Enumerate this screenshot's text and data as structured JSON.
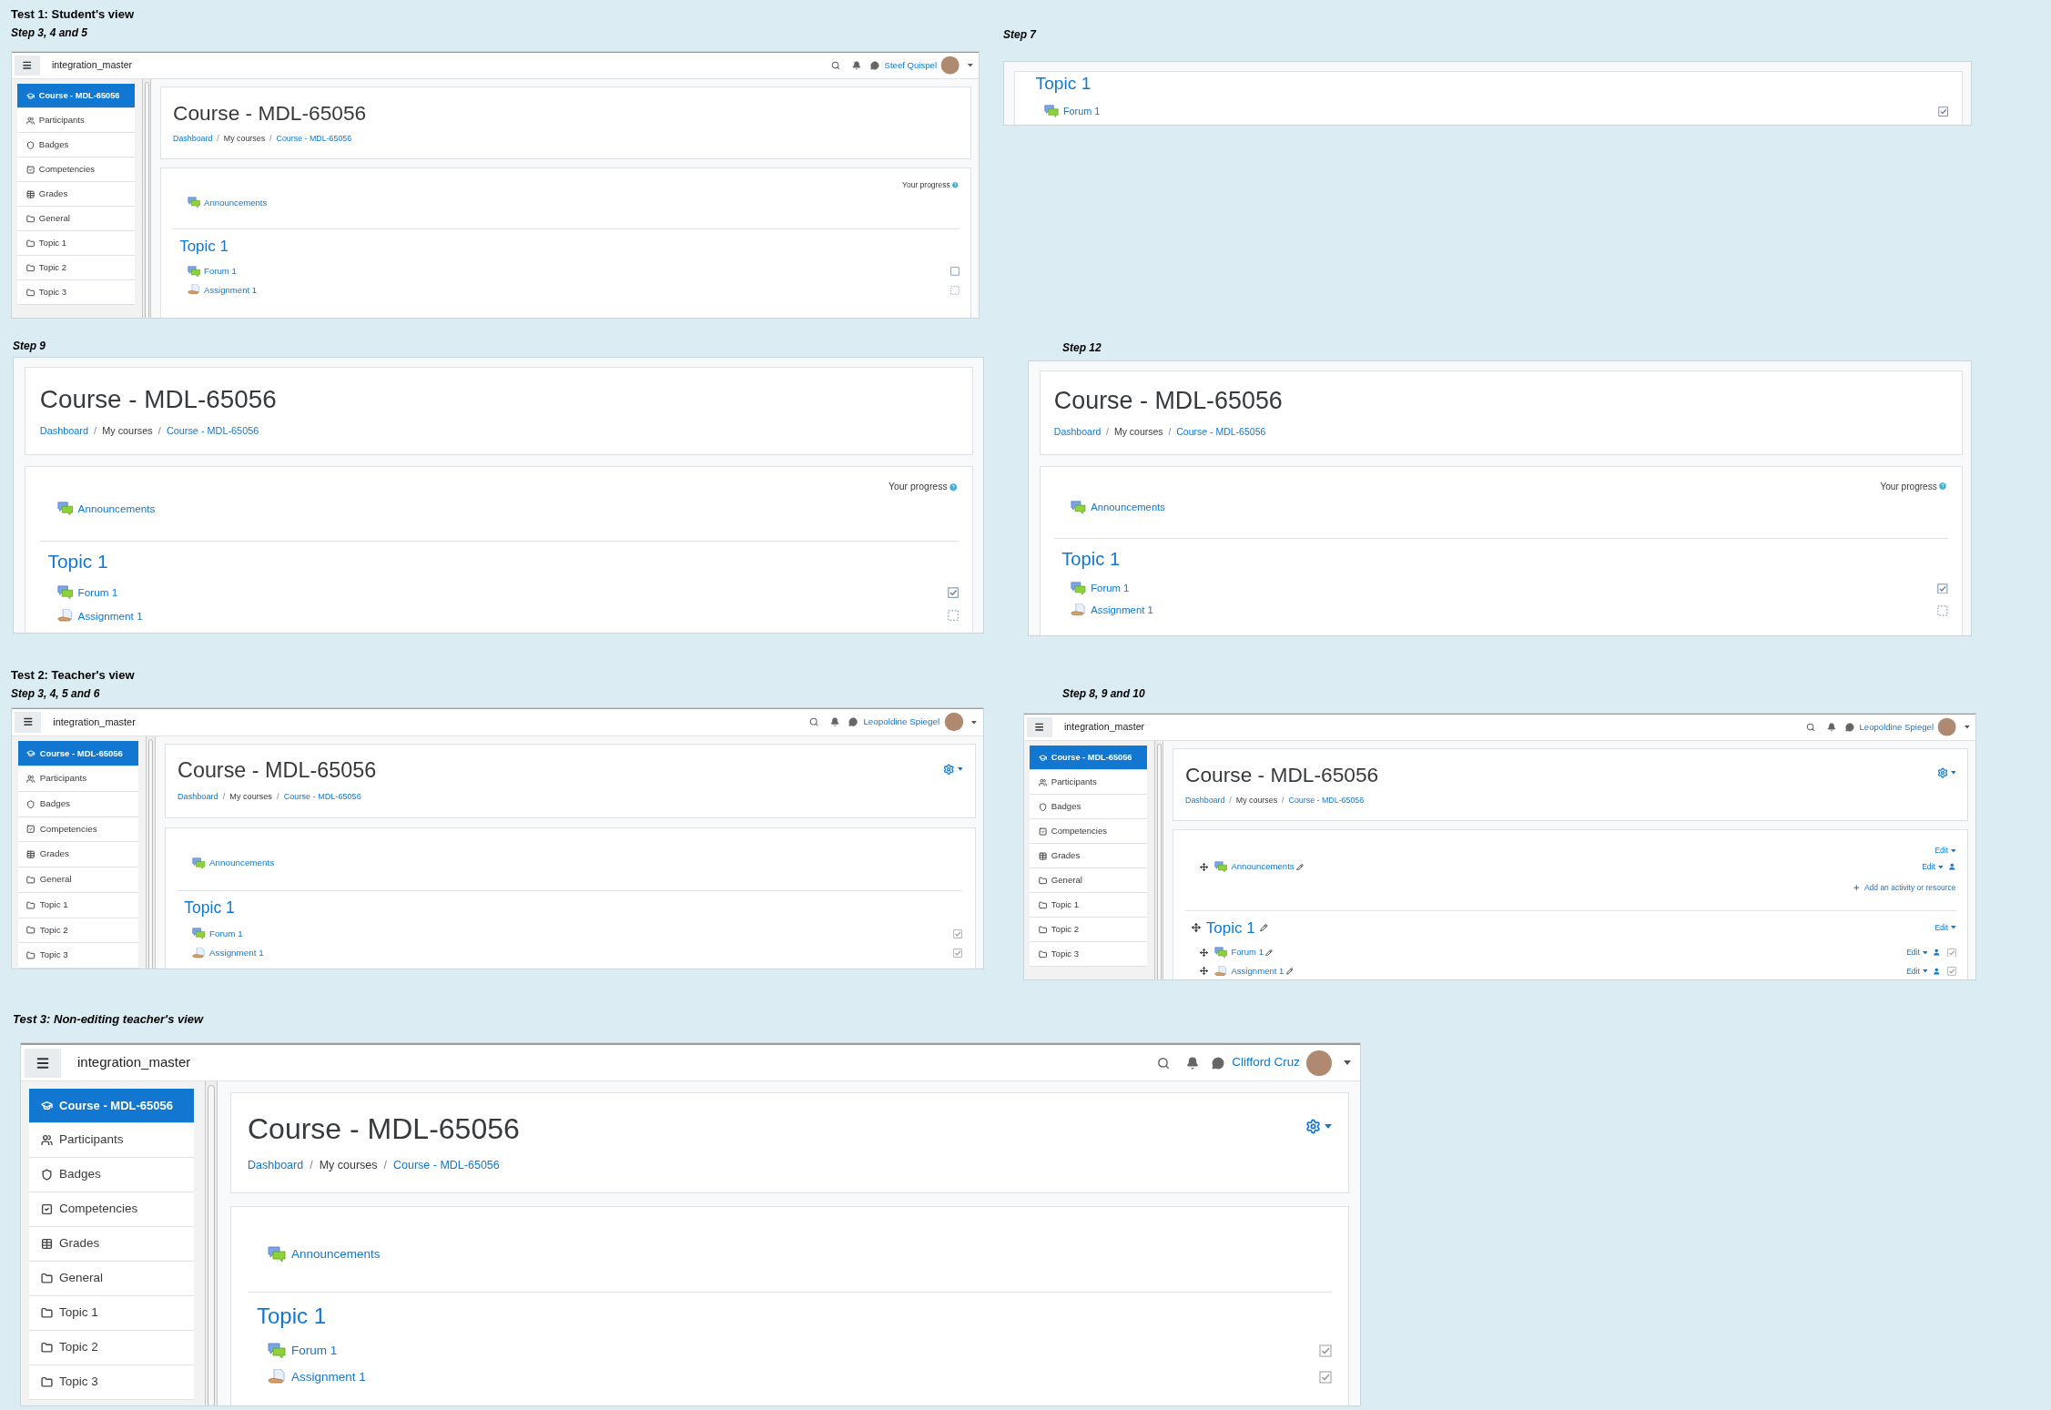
{
  "groups": [
    {
      "heading": {
        "text": "Test 1: Student's view",
        "italic": false
      },
      "step": "Step 3, 4 and 5",
      "screen": {
        "navbar": {
          "site": "integration_master",
          "user": "Steef Quispel"
        },
        "sidebar": [
          {
            "label": "Course - MDL-65056",
            "kind": "course",
            "selected": true
          },
          {
            "label": "Participants",
            "kind": "participants",
            "selected": false
          },
          {
            "label": "Badges",
            "kind": "badges",
            "selected": false
          },
          {
            "label": "Competencies",
            "kind": "competencies",
            "selected": false
          },
          {
            "label": "Grades",
            "kind": "grades",
            "selected": false
          },
          {
            "label": "General",
            "kind": "folder",
            "selected": false
          },
          {
            "label": "Topic 1",
            "kind": "folder",
            "selected": false
          },
          {
            "label": "Topic 2",
            "kind": "folder",
            "selected": false
          },
          {
            "label": "Topic 3",
            "kind": "folder",
            "selected": false
          }
        ],
        "header": {
          "title": "Course - MDL-65056",
          "gear": false,
          "breadcrumb": [
            {
              "label": "Dashboard",
              "link": true,
              "separator": "/"
            },
            {
              "label": "My courses",
              "link": false,
              "separator": "/"
            },
            {
              "label": "Course - MDL-65056",
              "link": true
            }
          ]
        },
        "content": {
          "editing": false,
          "progress": "Your progress",
          "sections": [
            {
              "activities": [
                {
                  "name": "Announcements",
                  "kind": "forum"
                }
              ]
            },
            {
              "title": "Topic 1",
              "activities": [
                {
                  "name": "Forum 1",
                  "kind": "forum",
                  "completion": {
                    "kind": "manual",
                    "checked": false,
                    "disabled": false
                  }
                },
                {
                  "name": "Assignment 1",
                  "kind": "assignment",
                  "completion": {
                    "kind": "auto",
                    "checked": false,
                    "disabled": false
                  }
                }
              ]
            }
          ]
        }
      }
    },
    {
      "step": "Step 7",
      "screen": {
        "content": {
          "editing": false,
          "sections": [
            {
              "title": "Topic 1",
              "activities": [
                {
                  "name": "Forum 1",
                  "kind": "forum",
                  "completion": {
                    "kind": "manual",
                    "checked": true,
                    "disabled": false
                  }
                }
              ]
            }
          ]
        }
      }
    },
    {
      "step": "Step 9",
      "screen": {
        "header": {
          "title": "Course - MDL-65056",
          "gear": false,
          "breadcrumb": [
            {
              "label": "Dashboard",
              "link": true,
              "separator": "/"
            },
            {
              "label": "My courses",
              "link": false,
              "separator": "/"
            },
            {
              "label": "Course - MDL-65056",
              "link": true
            }
          ]
        },
        "content": {
          "editing": false,
          "progress": "Your progress",
          "sections": [
            {
              "activities": [
                {
                  "name": "Announcements",
                  "kind": "forum"
                }
              ]
            },
            {
              "title": "Topic 1",
              "activities": [
                {
                  "name": "Forum 1",
                  "kind": "forum",
                  "completion": {
                    "kind": "manual",
                    "checked": true,
                    "disabled": false
                  }
                },
                {
                  "name": "Assignment 1",
                  "kind": "assignment",
                  "completion": {
                    "kind": "auto",
                    "checked": false,
                    "disabled": false
                  }
                }
              ]
            }
          ]
        }
      }
    },
    {
      "step": "Step 12",
      "screen": {
        "header": {
          "title": "Course - MDL-65056",
          "gear": false,
          "breadcrumb": [
            {
              "label": "Dashboard",
              "link": true,
              "separator": "/"
            },
            {
              "label": "My courses",
              "link": false,
              "separator": "/"
            },
            {
              "label": "Course - MDL-65056",
              "link": true
            }
          ]
        },
        "content": {
          "editing": false,
          "progress": "Your progress",
          "sections": [
            {
              "activities": [
                {
                  "name": "Announcements",
                  "kind": "forum"
                }
              ]
            },
            {
              "title": "Topic 1",
              "activities": [
                {
                  "name": "Forum 1",
                  "kind": "forum",
                  "completion": {
                    "kind": "manual",
                    "checked": true,
                    "disabled": false
                  }
                },
                {
                  "name": "Assignment 1",
                  "kind": "assignment",
                  "completion": {
                    "kind": "auto",
                    "checked": false,
                    "disabled": false
                  }
                }
              ]
            }
          ]
        }
      }
    },
    {
      "heading": {
        "text": "Test 2: Teacher's view",
        "italic": false
      },
      "step": "Step 3, 4, 5 and 6",
      "screen": {
        "navbar": {
          "site": "integration_master",
          "user": "Leopoldine Spiegel"
        },
        "sidebar": [
          {
            "label": "Course - MDL-65056",
            "kind": "course",
            "selected": true
          },
          {
            "label": "Participants",
            "kind": "participants",
            "selected": false
          },
          {
            "label": "Badges",
            "kind": "badges",
            "selected": false
          },
          {
            "label": "Competencies",
            "kind": "competencies",
            "selected": false
          },
          {
            "label": "Grades",
            "kind": "grades",
            "selected": false
          },
          {
            "label": "General",
            "kind": "folder",
            "selected": false
          },
          {
            "label": "Topic 1",
            "kind": "folder",
            "selected": false
          },
          {
            "label": "Topic 2",
            "kind": "folder",
            "selected": false
          },
          {
            "label": "Topic 3",
            "kind": "folder",
            "selected": false
          }
        ],
        "header": {
          "title": "Course - MDL-65056",
          "gear": true,
          "breadcrumb": [
            {
              "label": "Dashboard",
              "link": true,
              "separator": "/"
            },
            {
              "label": "My courses",
              "link": false,
              "separator": "/"
            },
            {
              "label": "Course - MDL-65056",
              "link": true
            }
          ]
        },
        "content": {
          "editing": false,
          "sections": [
            {
              "activities": [
                {
                  "name": "Announcements",
                  "kind": "forum"
                }
              ]
            },
            {
              "title": "Topic 1",
              "activities": [
                {
                  "name": "Forum 1",
                  "kind": "forum",
                  "completion": {
                    "kind": "manual",
                    "checked": true,
                    "disabled": true
                  }
                },
                {
                  "name": "Assignment 1",
                  "kind": "assignment",
                  "completion": {
                    "kind": "auto",
                    "checked": true,
                    "disabled": true
                  }
                }
              ]
            }
          ]
        }
      }
    },
    {
      "step": "Step 8, 9 and 10",
      "screen": {
        "navbar": {
          "site": "integration_master",
          "user": "Leopoldine Spiegel"
        },
        "sidebar": [
          {
            "label": "Course - MDL-65056",
            "kind": "course",
            "selected": true
          },
          {
            "label": "Participants",
            "kind": "participants",
            "selected": false
          },
          {
            "label": "Badges",
            "kind": "badges",
            "selected": false
          },
          {
            "label": "Competencies",
            "kind": "competencies",
            "selected": false
          },
          {
            "label": "Grades",
            "kind": "grades",
            "selected": false
          },
          {
            "label": "General",
            "kind": "folder",
            "selected": false
          },
          {
            "label": "Topic 1",
            "kind": "folder",
            "selected": false
          },
          {
            "label": "Topic 2",
            "kind": "folder",
            "selected": false
          },
          {
            "label": "Topic 3",
            "kind": "folder",
            "selected": false
          }
        ],
        "header": {
          "title": "Course - MDL-65056",
          "gear": true,
          "breadcrumb": [
            {
              "label": "Dashboard",
              "link": true,
              "separator": "/"
            },
            {
              "label": "My courses",
              "link": false,
              "separator": "/"
            },
            {
              "label": "Course - MDL-65056",
              "link": true
            }
          ]
        },
        "content": {
          "editing": true,
          "sections": [
            {
              "edit": "Edit",
              "add": "Add an activity or resource",
              "activities": [
                {
                  "name": "Announcements",
                  "kind": "forum",
                  "edit": "Edit"
                }
              ]
            },
            {
              "title": "Topic 1",
              "edit": "Edit",
              "activities": [
                {
                  "name": "Forum 1",
                  "kind": "forum",
                  "edit": "Edit",
                  "completion": {
                    "kind": "manual",
                    "checked": true,
                    "disabled": true
                  }
                },
                {
                  "name": "Assignment 1",
                  "kind": "assignment",
                  "edit": "Edit",
                  "completion": {
                    "kind": "auto",
                    "checked": true,
                    "disabled": true
                  }
                }
              ]
            }
          ]
        }
      }
    },
    {
      "heading": {
        "text": "Test 3: Non-editing teacher's view",
        "italic": true
      },
      "screen": {
        "navbar": {
          "site": "integration_master",
          "user": "Clifford Cruz"
        },
        "sidebar": [
          {
            "label": "Course - MDL-65056",
            "kind": "course",
            "selected": true
          },
          {
            "label": "Participants",
            "kind": "participants",
            "selected": false
          },
          {
            "label": "Badges",
            "kind": "badges",
            "selected": false
          },
          {
            "label": "Competencies",
            "kind": "competencies",
            "selected": false
          },
          {
            "label": "Grades",
            "kind": "grades",
            "selected": false
          },
          {
            "label": "General",
            "kind": "folder",
            "selected": false
          },
          {
            "label": "Topic 1",
            "kind": "folder",
            "selected": false
          },
          {
            "label": "Topic 2",
            "kind": "folder",
            "selected": false
          },
          {
            "label": "Topic 3",
            "kind": "folder",
            "selected": false
          }
        ],
        "header": {
          "title": "Course - MDL-65056",
          "gear": true,
          "breadcrumb": [
            {
              "label": "Dashboard",
              "link": true,
              "separator": "/"
            },
            {
              "label": "My courses",
              "link": false,
              "separator": "/"
            },
            {
              "label": "Course - MDL-65056",
              "link": true
            }
          ]
        },
        "content": {
          "editing": false,
          "sections": [
            {
              "activities": [
                {
                  "name": "Announcements",
                  "kind": "forum"
                }
              ]
            },
            {
              "title": "Topic 1",
              "activities": [
                {
                  "name": "Forum 1",
                  "kind": "forum",
                  "completion": {
                    "kind": "manual",
                    "checked": true,
                    "disabled": true
                  }
                },
                {
                  "name": "Assignment 1",
                  "kind": "assignment",
                  "completion": {
                    "kind": "auto",
                    "checked": true,
                    "disabled": true
                  }
                }
              ]
            }
          ]
        }
      }
    }
  ]
}
